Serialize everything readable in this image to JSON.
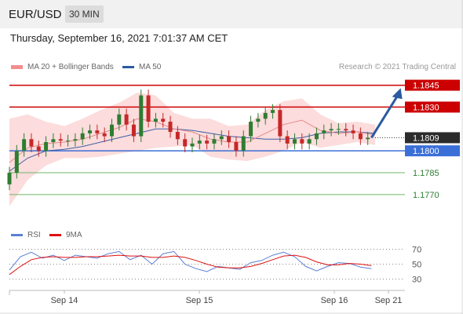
{
  "header": {
    "symbol": "EUR/USD",
    "timeframe": "30 MIN"
  },
  "date_line": "Thursday, September 16, 2021 7:01:37 AM CET",
  "legend": {
    "ma_bb": "MA 20 + Bollinger Bands",
    "ma50": "MA 50",
    "credit": "Research © 2021 Trading Central"
  },
  "rsi_legend": {
    "rsi": "RSI",
    "ma9": "9MA"
  },
  "colors": {
    "resistance": "#cc0000",
    "support": "#3b6fd8",
    "target": "#70b36a",
    "rsi": "#5b7fd6",
    "ma": "#e01010",
    "band": "#fbd3d3",
    "candle_up": "#2e7d32",
    "candle_down": "#c62828",
    "arrow": "#2c5aa0"
  },
  "chart_data": [
    {
      "type": "line",
      "title": "EUR/USD 30 MIN",
      "x_ticks": [
        "Sep 14",
        "Sep 15",
        "Sep 16",
        "Sep 21"
      ],
      "ylim": [
        1.175,
        1.1855
      ],
      "series": [
        {
          "name": "MA 50",
          "x": [
            0,
            5,
            10,
            15,
            20,
            25,
            30,
            35,
            40,
            45,
            50,
            55,
            60,
            65,
            70,
            75,
            80,
            85,
            90,
            95,
            100
          ],
          "values": [
            1.1786,
            1.1795,
            1.18,
            1.1801,
            1.1803,
            1.1806,
            1.1809,
            1.1812,
            1.1815,
            1.1815,
            1.1814,
            1.1812,
            1.181,
            1.1809,
            1.1808,
            1.1808,
            1.1809,
            1.1812,
            1.1813,
            1.1813,
            1.1812
          ]
        },
        {
          "name": "MA 20 + Bollinger Bands",
          "x": [
            0,
            5,
            10,
            15,
            20,
            25,
            30,
            35,
            40,
            45,
            50,
            55,
            60,
            65,
            70,
            75,
            80,
            85,
            90,
            95,
            100
          ],
          "values": [
            1.1792,
            1.1802,
            1.1805,
            1.1806,
            1.1808,
            1.1812,
            1.1816,
            1.1822,
            1.182,
            1.1815,
            1.1813,
            1.1808,
            1.1806,
            1.1806,
            1.1812,
            1.1818,
            1.1821,
            1.1814,
            1.1812,
            1.1813,
            1.1811
          ]
        }
      ],
      "bands": {
        "x": [
          0,
          5,
          10,
          15,
          20,
          25,
          30,
          35,
          40,
          45,
          50,
          55,
          60,
          65,
          70,
          75,
          80,
          85,
          90,
          95,
          100
        ],
        "upper": [
          1.1822,
          1.1825,
          1.182,
          1.1817,
          1.1822,
          1.1828,
          1.1833,
          1.184,
          1.1838,
          1.1826,
          1.1822,
          1.1822,
          1.1817,
          1.1818,
          1.1828,
          1.1834,
          1.1836,
          1.1825,
          1.1819,
          1.182,
          1.1818
        ],
        "lower": [
          1.1762,
          1.178,
          1.179,
          1.1795,
          1.1795,
          1.1796,
          1.1798,
          1.18,
          1.1802,
          1.1803,
          1.1804,
          1.1796,
          1.1794,
          1.1793,
          1.1796,
          1.18,
          1.1806,
          1.1802,
          1.1804,
          1.1806,
          1.1804
        ]
      },
      "candles": {
        "x": [
          0,
          2,
          4,
          6,
          8,
          10,
          12,
          14,
          16,
          18,
          20,
          22,
          24,
          26,
          28,
          30,
          32,
          34,
          36,
          38,
          40,
          42,
          44,
          46,
          48,
          50,
          52,
          54,
          56,
          58,
          60,
          62,
          64,
          66,
          68,
          70,
          72,
          74,
          76,
          78,
          80,
          82,
          84,
          86,
          88,
          90,
          92,
          94,
          96,
          98
        ],
        "close": [
          1.1785,
          1.18,
          1.1808,
          1.1803,
          1.18,
          1.1806,
          1.1808,
          1.1807,
          1.1807,
          1.1808,
          1.1812,
          1.1814,
          1.1812,
          1.181,
          1.1818,
          1.1825,
          1.1818,
          1.181,
          1.1838,
          1.182,
          1.1822,
          1.182,
          1.1813,
          1.1808,
          1.1803,
          1.1805,
          1.1807,
          1.1805,
          1.1808,
          1.181,
          1.1806,
          1.18,
          1.181,
          1.182,
          1.1822,
          1.1826,
          1.1828,
          1.181,
          1.1805,
          1.1808,
          1.1805,
          1.1808,
          1.1812,
          1.1814,
          1.1815,
          1.1815,
          1.1814,
          1.1812,
          1.1808,
          1.1809
        ]
      },
      "levels": [
        {
          "value": 1.1845,
          "label": "1.1845",
          "kind": "resistance"
        },
        {
          "value": 1.183,
          "label": "1.1830",
          "kind": "resistance"
        },
        {
          "value": 1.1809,
          "label": "1.1809",
          "kind": "last"
        },
        {
          "value": 1.18,
          "label": "1.1800",
          "kind": "support"
        },
        {
          "value": 1.1785,
          "label": "1.1785",
          "kind": "target"
        },
        {
          "value": 1.177,
          "label": "1.1770",
          "kind": "target"
        }
      ],
      "arrow": {
        "from_x": 99,
        "from_y": 1.1809,
        "to_x": 107,
        "to_y": 1.1843
      }
    },
    {
      "type": "line",
      "ylim": [
        20,
        80
      ],
      "y_ticks": [
        70,
        50,
        30
      ],
      "series": [
        {
          "name": "RSI",
          "x": [
            0,
            3,
            6,
            9,
            12,
            15,
            18,
            21,
            24,
            27,
            30,
            33,
            36,
            39,
            42,
            45,
            48,
            51,
            54,
            57,
            60,
            63,
            66,
            69,
            72,
            75,
            78,
            81,
            84,
            87,
            90,
            93,
            96,
            99
          ],
          "values": [
            42,
            60,
            66,
            58,
            62,
            55,
            62,
            60,
            58,
            64,
            67,
            56,
            62,
            50,
            64,
            67,
            50,
            44,
            40,
            47,
            45,
            43,
            52,
            55,
            62,
            66,
            60,
            47,
            41,
            47,
            52,
            51,
            46,
            44
          ]
        },
        {
          "name": "9MA",
          "x": [
            0,
            3,
            6,
            9,
            12,
            15,
            18,
            21,
            24,
            27,
            30,
            33,
            36,
            39,
            42,
            45,
            48,
            51,
            54,
            57,
            60,
            63,
            66,
            69,
            72,
            75,
            78,
            81,
            84,
            87,
            90,
            93,
            96,
            99
          ],
          "values": [
            36,
            47,
            56,
            59,
            60,
            59,
            59,
            60,
            60,
            61,
            62,
            61,
            61,
            59,
            59,
            61,
            59,
            55,
            50,
            46,
            45,
            45,
            47,
            51,
            56,
            61,
            62,
            59,
            53,
            49,
            49,
            51,
            50,
            48
          ]
        }
      ]
    }
  ]
}
